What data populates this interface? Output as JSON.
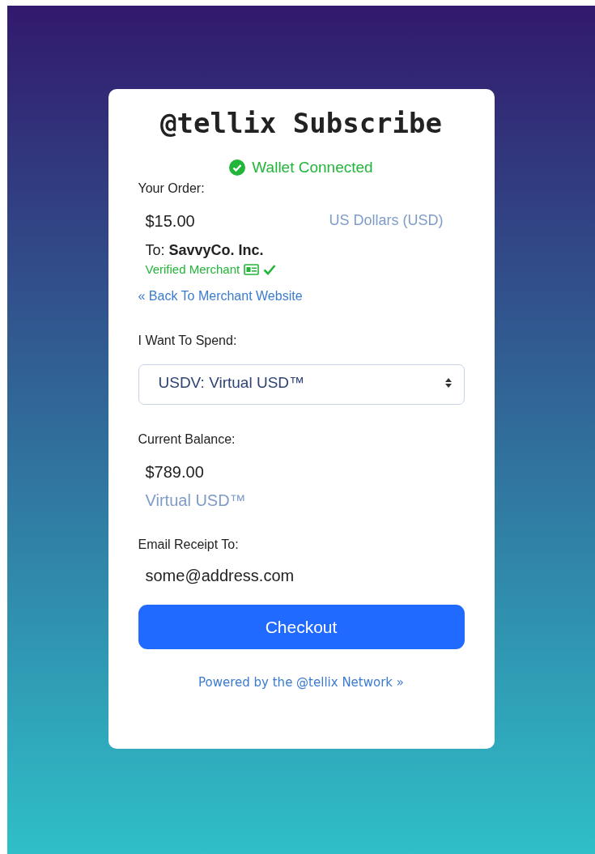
{
  "title": "@tellix Subscribe",
  "wallet_status": {
    "label": "Wallet Connected",
    "connected": true
  },
  "order": {
    "label": "Your Order:",
    "amount": "$15.00",
    "currency": "US Dollars (USD)",
    "to_label": "To:",
    "merchant": "SavvyCo. Inc.",
    "verified": true,
    "verified_label": "Verified Merchant"
  },
  "back_link": "« Back To Merchant Website",
  "spend": {
    "label": "I Want To Spend:",
    "value": "USDV: Virtual USD™"
  },
  "balance": {
    "label": "Current Balance:",
    "amount": "$789.00",
    "currency": "Virtual USD™"
  },
  "email": {
    "label": "Email Receipt To:",
    "value": "some@address.com"
  },
  "checkout_button": "Checkout",
  "footer_link": "Powered by the @tellix Network »"
}
